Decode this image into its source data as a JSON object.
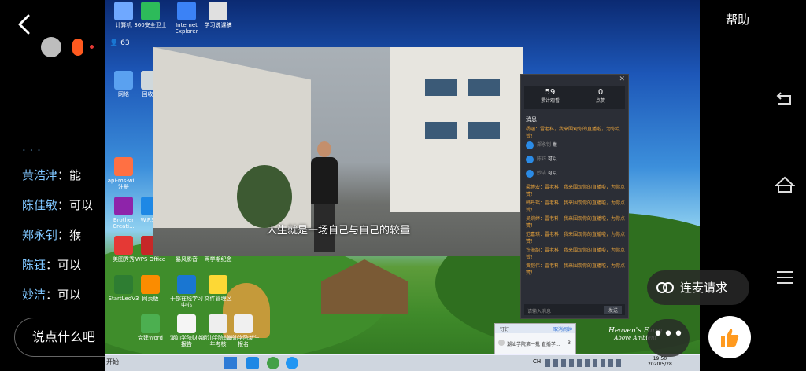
{
  "header": {
    "help_label": "帮助",
    "viewer_count": "63"
  },
  "comments": [
    {
      "name": "黄浩津",
      "sep": "：",
      "text": "能"
    },
    {
      "name": "陈佳敏",
      "sep": "：",
      "text": "可以"
    },
    {
      "name": "郑永钊",
      "sep": "：",
      "text": "猴"
    },
    {
      "name": "陈钰",
      "sep": "：",
      "text": "可以"
    },
    {
      "name": "妙洁",
      "sep": "：",
      "text": "可以"
    }
  ],
  "input": {
    "placeholder": "说点什么吧"
  },
  "actions": {
    "mic_request_label": "连麦请求",
    "more_label": "•••"
  },
  "desktop_icons": [
    {
      "label": "计算机"
    },
    {
      "label": "360安全卫士"
    },
    {
      "label": "Internet Explorer"
    },
    {
      "label": "学习说课稿"
    },
    {
      "label": "网络"
    },
    {
      "label": "回收站"
    },
    {
      "label": "api-ms-wi... 注册"
    },
    {
      "label": "Brother Creati..."
    },
    {
      "label": "美图秀秀"
    },
    {
      "label": "StartLedV3"
    },
    {
      "label": "网页版"
    },
    {
      "label": "干部在线学习中心"
    },
    {
      "label": "W.P.S..."
    },
    {
      "label": "WPS Office"
    },
    {
      "label": "暴风影音"
    },
    {
      "label": "两学期纪念"
    },
    {
      "label": "潮汕学院新生报名"
    },
    {
      "label": "文件管理区"
    },
    {
      "label": "党建Word"
    },
    {
      "label": "潮汕学院财务报告"
    },
    {
      "label": "潮汕学院前三年考核"
    }
  ],
  "video": {
    "subtitle": "人生就是一场自己与自己的较量"
  },
  "live_panel": {
    "stats": [
      {
        "value": "59",
        "label": "累计观看"
      },
      {
        "value": "0",
        "label": "点赞"
      }
    ],
    "messages_title": "消息",
    "messages": [
      {
        "type": "system",
        "text": "杨涵：雷老科，我来围观你的直播啦，为你点赞！"
      },
      {
        "type": "chat",
        "name": "郑永钊",
        "text": "猴"
      },
      {
        "type": "chat",
        "name": "陈钰",
        "text": "可以"
      },
      {
        "type": "chat",
        "name": "妙洁",
        "text": "可以"
      },
      {
        "type": "system",
        "text": "梁博宏：雷老科，我来围观你的直播啦，为你点赞！"
      },
      {
        "type": "system",
        "text": "韩丹瑶：雷老科，我来围观你的直播啦，为你点赞！"
      },
      {
        "type": "system",
        "text": "吴婉婷：雷老科，我来围观你的直播啦，为你点赞！"
      },
      {
        "type": "system",
        "text": "范嘉琪：雷老科，我来围观你的直播啦，为你点赞！"
      },
      {
        "type": "system",
        "text": "许海韵：雷老科，我来围观你的直播啦，为你点赞！"
      },
      {
        "type": "system",
        "text": "黄恺伟：雷老科，我来围观你的直播啦，为你点赞！"
      }
    ],
    "input_placeholder": "请输入消息",
    "send_label": "发送"
  },
  "notification": {
    "title": "钉钉",
    "cancel_label": "取消闹钟",
    "item": "潮汕学院第一批 直播学...",
    "count": "3"
  },
  "watermark": {
    "line1": "Heaven's Farm",
    "line2": "Above Ambient"
  },
  "taskbar": {
    "start_label": "开始",
    "lang": "CH",
    "time": "19:50",
    "date": "2020/5/28"
  },
  "colors": {
    "accent_orange": "#ff5a1f",
    "name_blue": "#7fc6ff",
    "like_orange": "#ff9a1f",
    "system_msg": "#e6a23c"
  }
}
